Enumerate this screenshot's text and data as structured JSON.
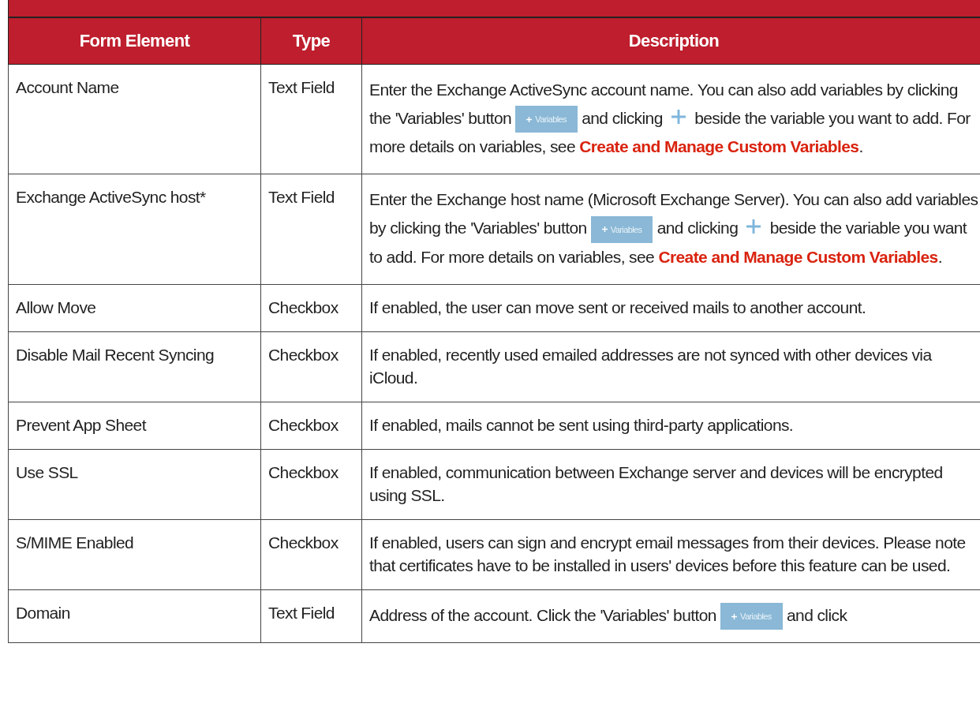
{
  "table": {
    "columns": [
      "Form Element",
      "Type",
      "Description"
    ],
    "rows": [
      {
        "element": "Account Name",
        "type": "Text Field",
        "description": [
          {
            "kind": "text",
            "text": "Enter the Exchange ActiveSync account name. You can also add variables by clicking the 'Variables' button "
          },
          {
            "kind": "button",
            "label": "Variables"
          },
          {
            "kind": "text",
            "text": " and clicking "
          },
          {
            "kind": "plus"
          },
          {
            "kind": "text",
            "text": " beside the variable you want to add. For more details on variables, see "
          },
          {
            "kind": "link",
            "text": "Create and Manage Custom Variables"
          },
          {
            "kind": "text",
            "text": "."
          }
        ]
      },
      {
        "element": "Exchange ActiveSync host*",
        "type": "Text Field",
        "description": [
          {
            "kind": "text",
            "text": "Enter the Exchange host name (Microsoft Exchange Server). You can also add variables by clicking the 'Variables' button "
          },
          {
            "kind": "button",
            "label": "Variables"
          },
          {
            "kind": "text",
            "text": " and clicking "
          },
          {
            "kind": "plus"
          },
          {
            "kind": "text",
            "text": " beside the variable you want to add. For more details on variables, see "
          },
          {
            "kind": "link",
            "text": "Create and Manage Custom Variables"
          },
          {
            "kind": "text",
            "text": "."
          }
        ]
      },
      {
        "element": "Allow Move",
        "type": "Checkbox",
        "description": [
          {
            "kind": "text",
            "text": "If enabled, the user can move sent or received mails to another account."
          }
        ]
      },
      {
        "element": "Disable Mail Recent Syncing",
        "type": "Checkbox",
        "description": [
          {
            "kind": "text",
            "text": "If enabled, recently used emailed addresses are not synced with other devices via iCloud."
          }
        ]
      },
      {
        "element": "Prevent App Sheet",
        "type": "Checkbox",
        "description": [
          {
            "kind": "text",
            "text": "If enabled, mails cannot be sent using third-party applications."
          }
        ]
      },
      {
        "element": "Use SSL",
        "type": "Checkbox",
        "description": [
          {
            "kind": "text",
            "text": "If enabled, communication between Exchange server and devices will be encrypted using SSL."
          }
        ]
      },
      {
        "element": "S/MIME Enabled",
        "type": "Checkbox",
        "description": [
          {
            "kind": "text",
            "text": "If enabled, users can sign and encrypt email messages from their devices. Please note that certificates have to be installed in users' devices before this feature can be used."
          }
        ]
      },
      {
        "element": "Domain",
        "type": "Text Field",
        "description": [
          {
            "kind": "text",
            "text": "Address of the account. Click the 'Variables' button "
          },
          {
            "kind": "button",
            "label": "Variables"
          },
          {
            "kind": "text",
            "text": " and click"
          }
        ]
      }
    ]
  }
}
